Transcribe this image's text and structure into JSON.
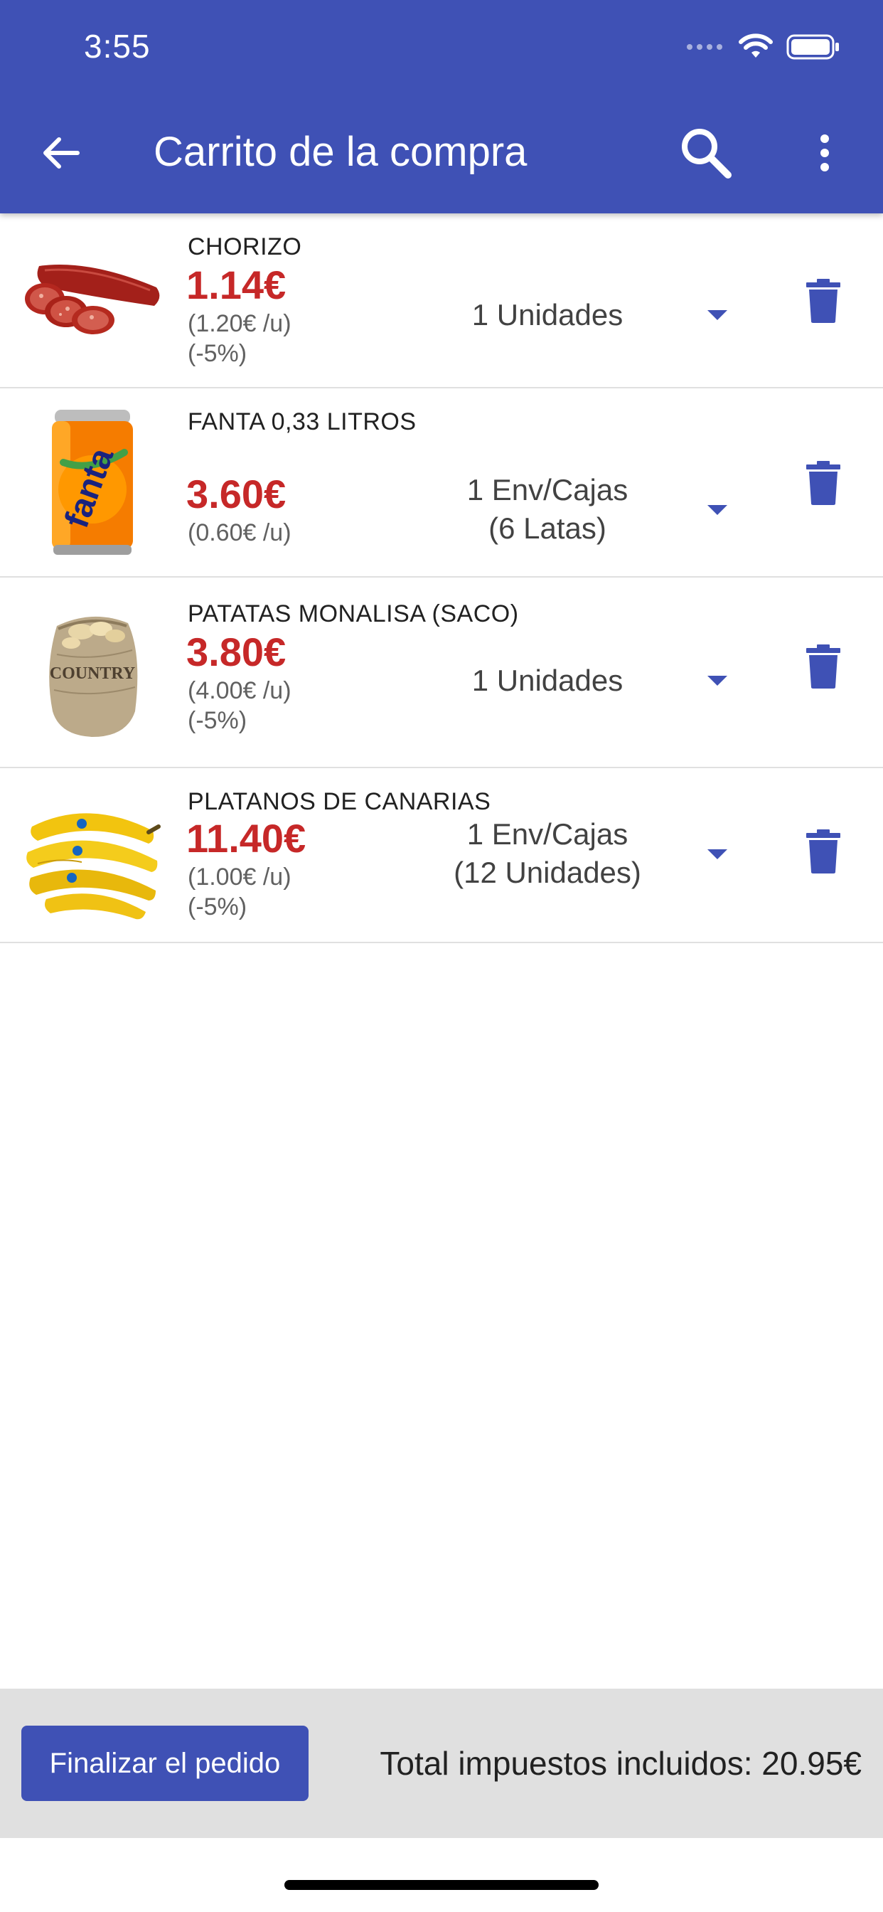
{
  "status_bar": {
    "time": "3:55"
  },
  "app_bar": {
    "title": "Carrito de la compra",
    "icons": [
      "back-arrow-icon",
      "search-icon",
      "more-vertical-icon"
    ]
  },
  "colors": {
    "primary": "#3f51b5",
    "price": "#c62828",
    "bottom_bar": "#e0e0e0"
  },
  "cart": {
    "items": [
      {
        "name": "CHORIZO",
        "price": "1.14€",
        "unit_price": "(1.20€ /u)",
        "discount": "(-5%)",
        "quantity_line1": "1 Unidades",
        "quantity_line2": "",
        "image": "chorizo-image"
      },
      {
        "name": "FANTA 0,33 LITROS",
        "price": "3.60€",
        "unit_price": "(0.60€ /u)",
        "discount": "",
        "quantity_line1": "1 Env/Cajas",
        "quantity_line2": "(6 Latas)",
        "image": "fanta-can-image"
      },
      {
        "name": "PATATAS MONALISA (SACO)",
        "price": "3.80€",
        "unit_price": "(4.00€ /u)",
        "discount": "(-5%)",
        "quantity_line1": "1 Unidades",
        "quantity_line2": "",
        "image": "potato-sack-image",
        "image_label": "COUNTRY"
      },
      {
        "name": "PLATANOS DE CANARIAS",
        "price": "11.40€",
        "unit_price": "(1.00€ /u)",
        "discount": "(-5%)",
        "quantity_line1": "1 Env/Cajas",
        "quantity_line2": "(12 Unidades)",
        "image": "bananas-image"
      }
    ]
  },
  "footer": {
    "checkout_label": "Finalizar el pedido",
    "total_label": "Total impuestos incluidos: 20.95€"
  }
}
